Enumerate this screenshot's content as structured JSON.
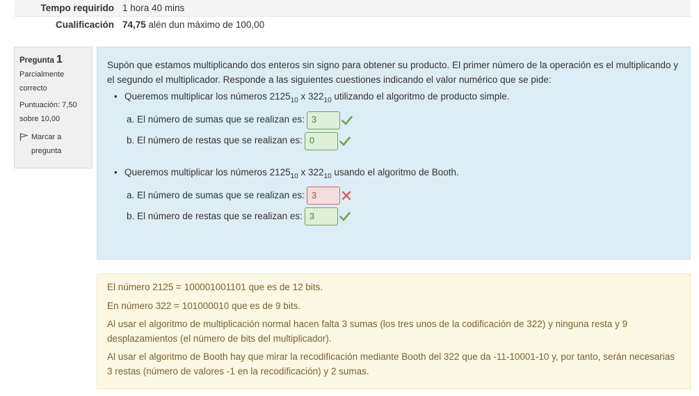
{
  "summary": {
    "rows": [
      {
        "label": "Tempo requirido",
        "value": "1 hora 40 mins"
      },
      {
        "label": "Cualificación",
        "score": "74,75",
        "value_rest": " alén dun máximo de 100,00"
      }
    ]
  },
  "question": {
    "prefix": "Pregunta",
    "number": "1",
    "state": "Parcialmente correcto",
    "grade": "Puntuación: 7,50 sobre 10,00",
    "flag_label": "Marcar a pregunta"
  },
  "formulation": {
    "intro": "Supón que estamos multiplicando dos enteros sin signo para obtener su producto. El primer número de la operación es el multiplicando y el segundo el multiplicador. Responde a las siguientes cuestiones indicando el valor numérico que se pide:",
    "blocks": [
      {
        "text_start": "Queremos multiplicar los números 2125",
        "sub1": "10",
        "mid": " x 322",
        "sub2": "10",
        "text_end": " utilizando el algoritmo de producto simple.",
        "answers": [
          {
            "label": "a. El número de sumas que se realizan es:",
            "value": "3",
            "status": "correct"
          },
          {
            "label": "b. El número de restas que se realizan es:",
            "value": "0",
            "status": "correct"
          }
        ]
      },
      {
        "text_start": "Queremos multiplicar los números 2125",
        "sub1": "10",
        "mid": " x 322",
        "sub2": "10",
        "text_end": " usando el algoritmo de Booth.",
        "answers": [
          {
            "label": "a. El número de sumas que se realizan es:",
            "value": "3",
            "status": "incorrect"
          },
          {
            "label": "b. El número de restas que se realizan es:",
            "value": "3",
            "status": "correct"
          }
        ]
      }
    ]
  },
  "feedback": {
    "lines": [
      "El número 2125 = 100001001101 que es de 12 bits.",
      "En número 322 = 101000010 que es de 9 bits.",
      "Al usar el algoritmo de multiplicación normal hacen falta 3 sumas (los tres unos de la codificación de 322) y ninguna resta y 9 desplazamientos (el número de bits del multiplicador).",
      "Al usar el algoritmo de Booth hay que mirar la recodificación mediante Booth del 322 que da -11-10001-10 y, por tanto, serán necesarias 3 restas (número de valores -1 en la recodificación) y 2 sumas."
    ]
  },
  "colors": {
    "correct": "#6fa64a",
    "incorrect": "#e05a5a",
    "formulation_bg": "#dcedf5",
    "feedback_bg": "#fcf8e3"
  },
  "icons": {
    "correct": "check-icon",
    "incorrect": "cross-icon",
    "flag": "flag-icon"
  }
}
